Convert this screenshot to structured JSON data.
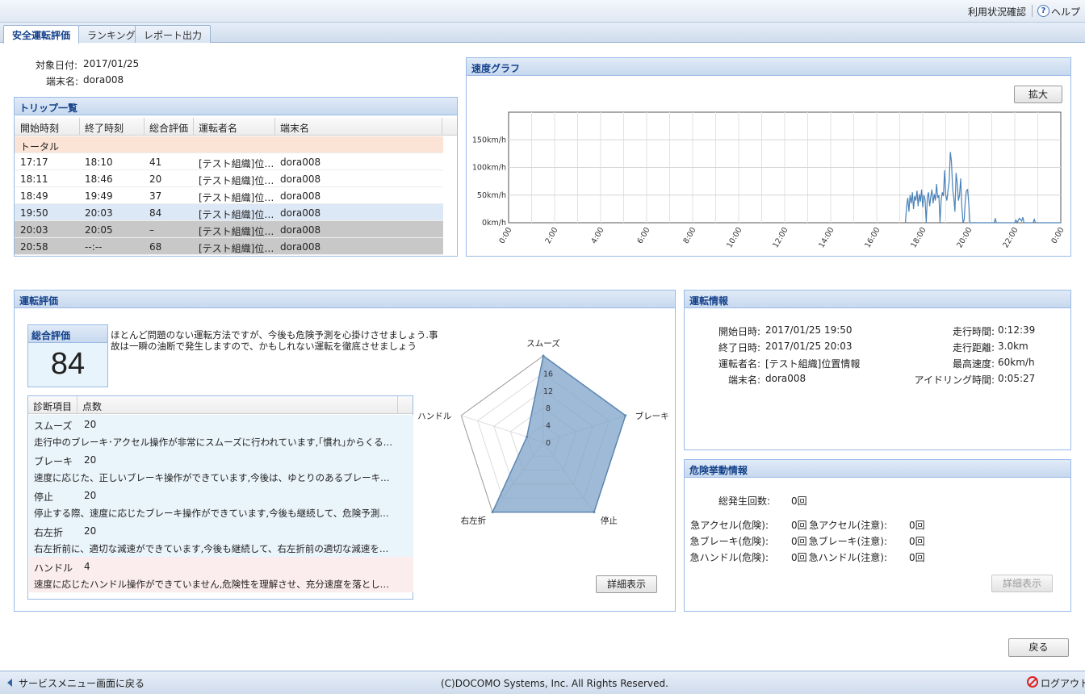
{
  "topbar": {
    "usage_label": "利用状況確認",
    "help_label": "ヘルプ"
  },
  "tabs": [
    "安全運転評価",
    "ランキング",
    "レポート出力"
  ],
  "header": {
    "date_label": "対象日付:",
    "date_value": "2017/01/25",
    "terminal_label": "端末名:",
    "terminal_value": "dora008"
  },
  "trips": {
    "title": "トリップ一覧",
    "columns": [
      "開始時刻",
      "終了時刻",
      "総合評価",
      "運転者名",
      "端末名"
    ],
    "total_label": "トータル",
    "rows": [
      [
        "17:17",
        "18:10",
        "41",
        "[テスト組織]位…",
        "dora008"
      ],
      [
        "18:11",
        "18:46",
        "20",
        "[テスト組織]位…",
        "dora008"
      ],
      [
        "18:49",
        "19:49",
        "37",
        "[テスト組織]位…",
        "dora008"
      ],
      [
        "19:50",
        "20:03",
        "84",
        "[テスト組織]位…",
        "dora008"
      ],
      [
        "20:03",
        "20:05",
        "–",
        "[テスト組織]位…",
        "dora008"
      ],
      [
        "20:58",
        "--:--",
        "68",
        "[テスト組織]位…",
        "dora008"
      ]
    ]
  },
  "speed": {
    "title": "速度グラフ",
    "zoom_label": "拡大"
  },
  "chart_data": {
    "type": "line",
    "y_ticks": [
      "0km/h",
      "50km/h",
      "100km/h",
      "150km/h"
    ],
    "ylim": [
      0,
      200
    ],
    "x_ticks": [
      "0:00",
      "2:00",
      "4:00",
      "6:00",
      "8:00",
      "10:00",
      "12:00",
      "14:00",
      "16:00",
      "18:00",
      "20:00",
      "22:00",
      "0:00"
    ],
    "xlim_hours": [
      0,
      24
    ],
    "series": [
      {
        "color": "#4a82b8",
        "points": [
          [
            17.25,
            0
          ],
          [
            17.3,
            30
          ],
          [
            17.35,
            45
          ],
          [
            17.4,
            20
          ],
          [
            17.45,
            50
          ],
          [
            17.5,
            35
          ],
          [
            17.55,
            55
          ],
          [
            17.6,
            25
          ],
          [
            17.65,
            48
          ],
          [
            17.7,
            40
          ],
          [
            17.75,
            58
          ],
          [
            17.8,
            30
          ],
          [
            17.85,
            52
          ],
          [
            17.9,
            38
          ],
          [
            17.95,
            60
          ],
          [
            18.0,
            28
          ],
          [
            18.05,
            50
          ],
          [
            18.1,
            42
          ],
          [
            18.15,
            0
          ],
          [
            18.2,
            45
          ],
          [
            18.25,
            55
          ],
          [
            18.3,
            30
          ],
          [
            18.35,
            48
          ],
          [
            18.4,
            60
          ],
          [
            18.45,
            35
          ],
          [
            18.5,
            52
          ],
          [
            18.55,
            40
          ],
          [
            18.6,
            70
          ],
          [
            18.65,
            45
          ],
          [
            18.7,
            50
          ],
          [
            18.75,
            0
          ],
          [
            18.8,
            40
          ],
          [
            18.85,
            55
          ],
          [
            18.9,
            48
          ],
          [
            18.95,
            95
          ],
          [
            19.0,
            50
          ],
          [
            19.05,
            40
          ],
          [
            19.1,
            60
          ],
          [
            19.15,
            75
          ],
          [
            19.2,
            128
          ],
          [
            19.25,
            110
          ],
          [
            19.3,
            60
          ],
          [
            19.35,
            45
          ],
          [
            19.4,
            20
          ],
          [
            19.45,
            90
          ],
          [
            19.5,
            70
          ],
          [
            19.55,
            40
          ],
          [
            19.6,
            50
          ],
          [
            19.65,
            80
          ],
          [
            19.7,
            30
          ],
          [
            19.75,
            0
          ],
          [
            19.8,
            5
          ],
          [
            19.85,
            40
          ],
          [
            19.9,
            58
          ],
          [
            19.95,
            60
          ],
          [
            20.0,
            35
          ],
          [
            20.05,
            0
          ],
          [
            21.1,
            0
          ],
          [
            21.15,
            8
          ],
          [
            21.2,
            0
          ],
          [
            22.0,
            0
          ],
          [
            22.05,
            5
          ],
          [
            22.1,
            0
          ],
          [
            22.2,
            8
          ],
          [
            22.3,
            3
          ],
          [
            22.35,
            10
          ],
          [
            22.4,
            0
          ],
          [
            22.8,
            0
          ],
          [
            22.85,
            6
          ],
          [
            22.9,
            0
          ],
          [
            24.0,
            0
          ]
        ]
      }
    ]
  },
  "evaluation": {
    "title": "運転評価",
    "score_label": "総合評価",
    "score_value": "84",
    "comment_line1": "ほとんど問題のない運転方法ですが、今後も危険予測を心掛けさせましょう.事",
    "comment_line2": "故は一瞬の油断で発生しますので、かもしれない運転を徹底させましょう",
    "grid_headers": [
      "診断項目",
      "点数"
    ],
    "items": [
      {
        "name": "スムーズ",
        "score": "20",
        "text": "走行中のブレーキ･アクセル操作が非常にスムーズに行われています,｢慣れ｣からくる｢漫然運転｣には十分注意させましょう"
      },
      {
        "name": "ブレーキ",
        "score": "20",
        "text": "速度に応じた、正しいブレーキ操作ができています,今後は、ゆとりのあるブレーキ操作に加え、周囲の状況に注意させましょう"
      },
      {
        "name": "停止",
        "score": "20",
        "text": "停止する際、速度に応じたブレーキ操作ができています,今後も継続して、危険予測と速度に応じた停止を心掛けさせましょう"
      },
      {
        "name": "右左折",
        "score": "20",
        "text": "右左折前に、適切な減速ができています,今後も継続して、右左折前の適切な減速を心掛けさせましょう"
      },
      {
        "name": "ハンドル",
        "score": "4",
        "text": "速度に応じたハンドル操作ができていません,危険性を理解させ、充分速度を落としてからハンドル操作させましょう"
      }
    ],
    "detail_label": "詳細表示"
  },
  "radar": {
    "axes": [
      "スムーズ",
      "ブレーキ",
      "停止",
      "右左折",
      "ハンドル"
    ],
    "values": [
      20,
      20,
      20,
      20,
      4
    ],
    "max": 20,
    "ticks": [
      "0",
      "4",
      "8",
      "12",
      "16"
    ],
    "fill": "#7fa3c8",
    "stroke": "#5b86b3"
  },
  "drive_info": {
    "title": "運転情報",
    "left": [
      {
        "label": "開始日時:",
        "value": "2017/01/25 19:50"
      },
      {
        "label": "終了日時:",
        "value": "2017/01/25 20:03"
      },
      {
        "label": "運転者名:",
        "value": "[テスト組織]位置情報"
      },
      {
        "label": "端末名:",
        "value": "dora008"
      }
    ],
    "right": [
      {
        "label": "走行時間:",
        "value": "0:12:39"
      },
      {
        "label": "走行距離:",
        "value": "3.0km"
      },
      {
        "label": "最高速度:",
        "value": "60km/h"
      },
      {
        "label": "アイドリング時間:",
        "value": "0:05:27"
      }
    ]
  },
  "danger": {
    "title": "危険挙動情報",
    "total_label": "総発生回数:",
    "total_value": "0回",
    "rows": [
      {
        "l1": "急アクセル(危険):",
        "v1": "0回",
        "l2": "急アクセル(注意):",
        "v2": "0回"
      },
      {
        "l1": "急ブレーキ(危険):",
        "v1": "0回",
        "l2": "急ブレーキ(注意):",
        "v2": "0回"
      },
      {
        "l1": "急ハンドル(危険):",
        "v1": "0回",
        "l2": "急ハンドル(注意):",
        "v2": "0回"
      }
    ],
    "detail_label": "詳細表示"
  },
  "back_label": "戻る",
  "footer": {
    "menu_label": "サービスメニュー画面に戻る",
    "copyright": "(C)DOCOMO Systems, Inc. All Rights Reserved.",
    "logout_label": "ログアウト"
  },
  "colors": {
    "row_total": "#fbe3d5",
    "row_selected": "#dde8f6",
    "row_gray": "#c8c8c8",
    "diag_blue": "#eaf4fb",
    "diag_pink": "#fbecee",
    "score_box": "#e8f4fc"
  }
}
